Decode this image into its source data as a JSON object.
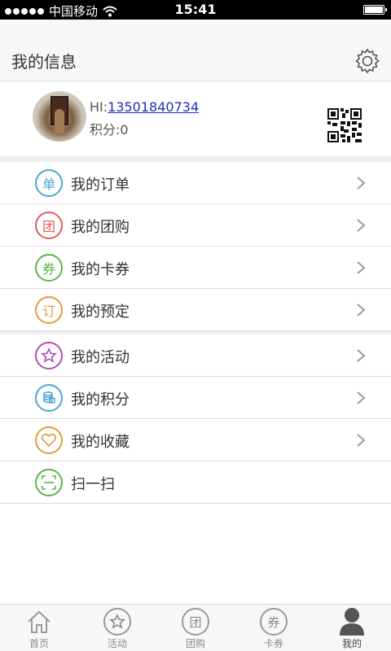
{
  "status_bar": {
    "carrier": "中国移动",
    "time": "15:41",
    "battery_level": 1.0
  },
  "header": {
    "title": "我的信息",
    "settings_icon": "gear-icon"
  },
  "profile": {
    "greeting_prefix": "HI:",
    "phone": "13501840734",
    "points_label": "积分:0",
    "qr_icon": "qr-code-icon"
  },
  "menu": {
    "group1": [
      {
        "label": "我的订单",
        "icon_char": "单",
        "color": "#4aa6d6"
      },
      {
        "label": "我的团购",
        "icon_char": "团",
        "color": "#e05d5d"
      },
      {
        "label": "我的卡券",
        "icon_char": "券",
        "color": "#5db34a"
      },
      {
        "label": "我的预定",
        "icon_char": "订",
        "color": "#e59a3b"
      }
    ],
    "group2": [
      {
        "label": "我的活动",
        "icon": "star-icon",
        "color": "#b64ab6"
      },
      {
        "label": "我的积分",
        "icon": "coins-icon",
        "color": "#4aa6d6"
      },
      {
        "label": "我的收藏",
        "icon": "heart-icon",
        "color": "#e59a3b"
      },
      {
        "label": "扫一扫",
        "icon": "scan-icon",
        "color": "#5db34a"
      }
    ]
  },
  "tabbar": {
    "tabs": [
      {
        "label": "首页",
        "icon": "home-icon"
      },
      {
        "label": "活动",
        "icon": "star-icon"
      },
      {
        "label": "团购",
        "icon_char": "团"
      },
      {
        "label": "卡券",
        "icon_char": "券"
      },
      {
        "label": "我的",
        "icon": "person-icon",
        "active": true
      }
    ]
  }
}
